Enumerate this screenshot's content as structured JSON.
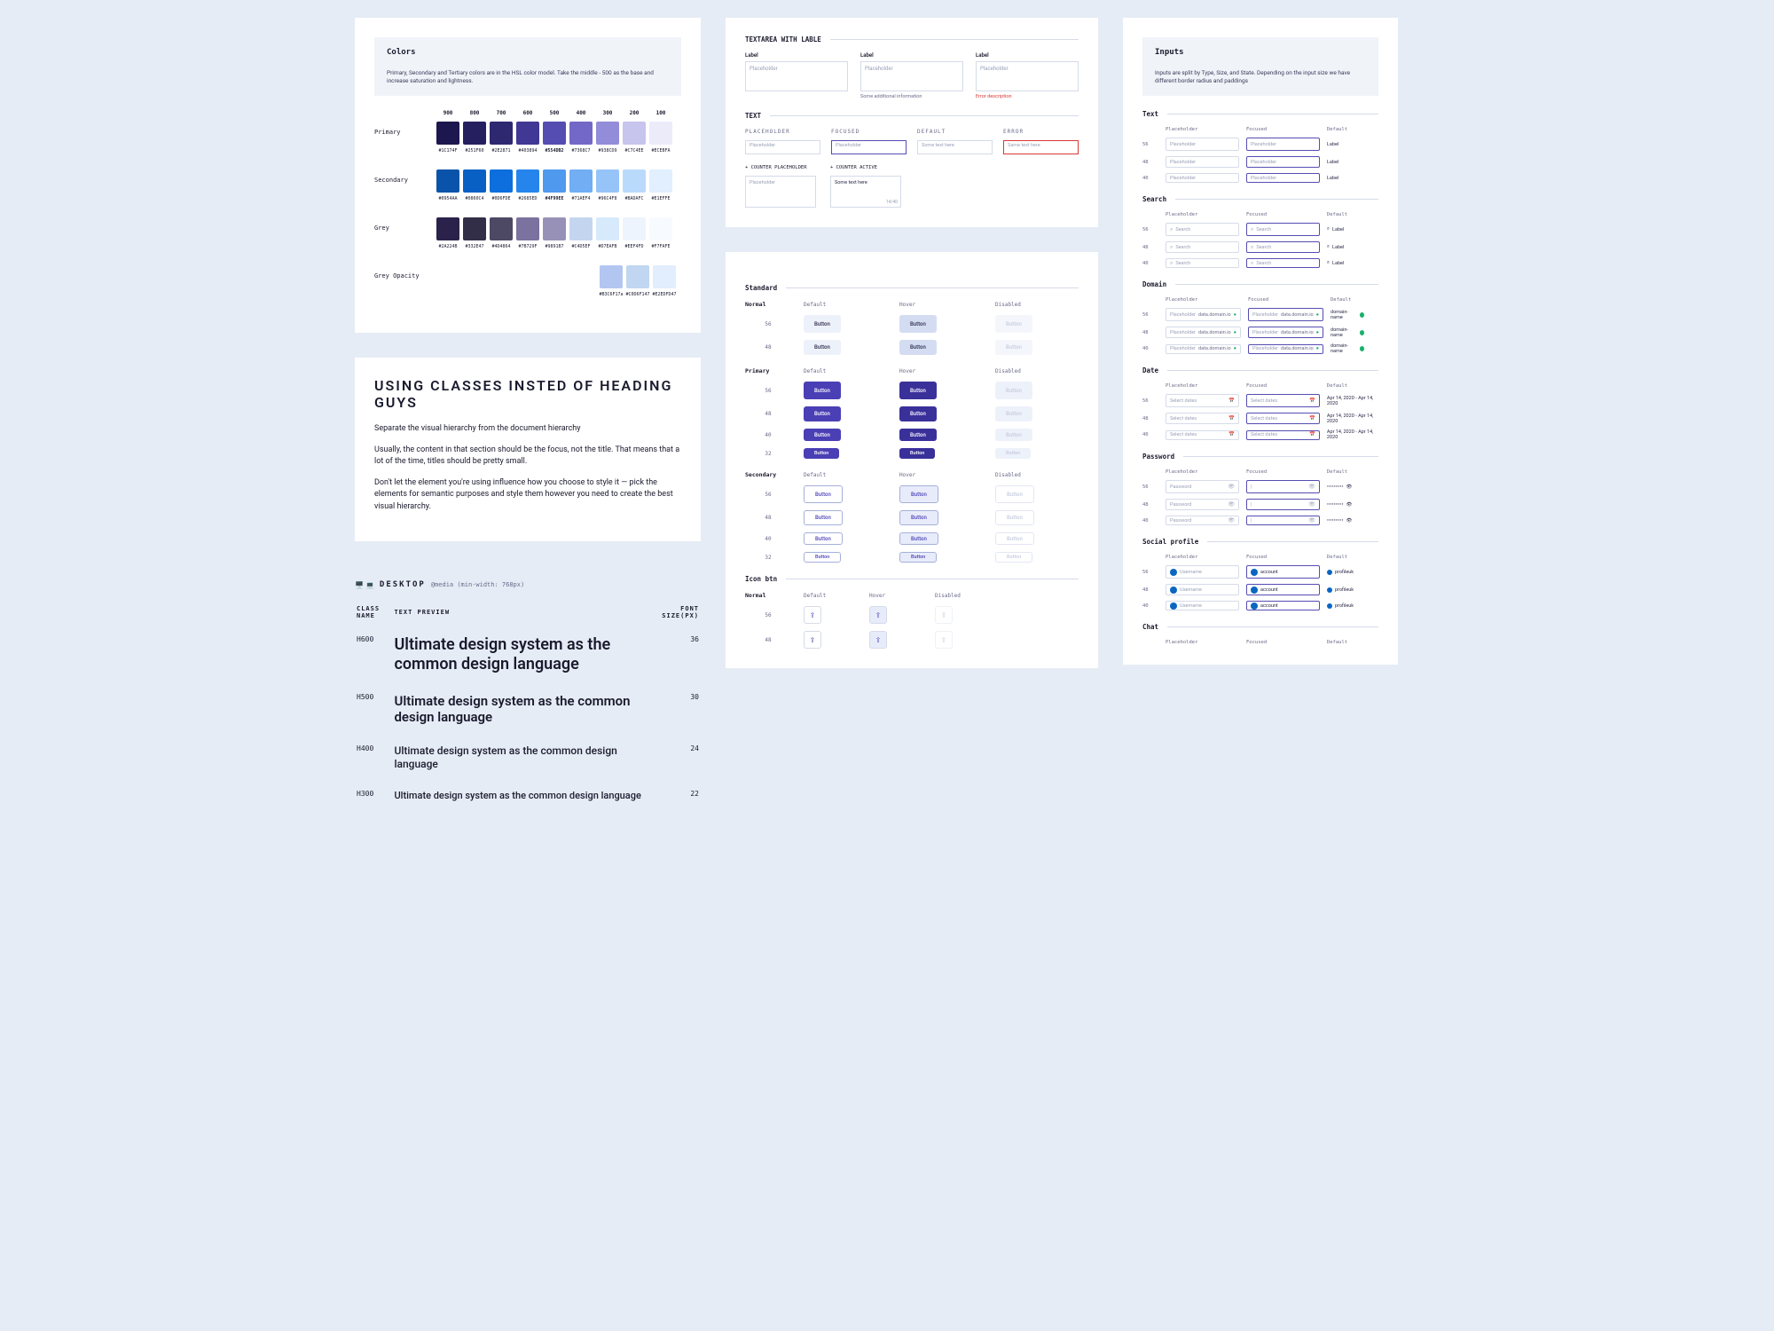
{
  "colorsPanel": {
    "title": "Colors",
    "description": "Primary, Secondary and Tertiary colors are in the HSL color model. Take the middle - 500 as the base and increase saturation and lightness.",
    "scaleLabels": [
      "900",
      "800",
      "700",
      "600",
      "500",
      "400",
      "300",
      "200",
      "100"
    ],
    "rows": [
      {
        "label": "Primary",
        "swatches": [
          {
            "hex": "#1C174F",
            "bold": false
          },
          {
            "hex": "#251F60",
            "bold": false
          },
          {
            "hex": "#2E2871",
            "bold": false
          },
          {
            "hex": "#403894",
            "bold": false
          },
          {
            "hex": "#554DB2",
            "bold": true
          },
          {
            "hex": "#7368C7",
            "bold": false
          },
          {
            "hex": "#938CD9",
            "bold": false
          },
          {
            "hex": "#C7C4EE",
            "bold": false
          },
          {
            "hex": "#ECEBFA",
            "bold": false
          }
        ]
      },
      {
        "label": "Secondary",
        "swatches": [
          {
            "hex": "#0954AA",
            "bold": false
          },
          {
            "hex": "#0860C4",
            "bold": false
          },
          {
            "hex": "#0D6FDE",
            "bold": false
          },
          {
            "hex": "#2685ED",
            "bold": false
          },
          {
            "hex": "#4F99EE",
            "bold": true
          },
          {
            "hex": "#71AEF4",
            "bold": false
          },
          {
            "hex": "#96C4F8",
            "bold": false
          },
          {
            "hex": "#BADAFC",
            "bold": false
          },
          {
            "hex": "#E1EFFE",
            "bold": false
          }
        ]
      },
      {
        "label": "Grey",
        "swatches": [
          {
            "hex": "#2A224B",
            "bold": false
          },
          {
            "hex": "#332E47",
            "bold": false
          },
          {
            "hex": "#4D4864",
            "bold": false
          },
          {
            "hex": "#7B729F",
            "bold": false
          },
          {
            "hex": "#9891B7",
            "bold": false
          },
          {
            "hex": "#C4D5EF",
            "bold": false
          },
          {
            "hex": "#D7EAFB",
            "bold": false
          },
          {
            "hex": "#EEF4FD",
            "bold": false
          },
          {
            "hex": "#F7FAFE",
            "bold": false
          }
        ]
      }
    ],
    "opacityRow": {
      "label": "Grey Opacity",
      "swatches": [
        {
          "hex": "#B3C6F17a",
          "bold": false
        },
        {
          "hex": "#C0D6F147",
          "bold": false
        },
        {
          "hex": "#E2EDFD47",
          "bold": false
        }
      ]
    }
  },
  "typography": {
    "title": "USING CLASSES INSTED OF HEADING GUYS",
    "p1": "Separate the visual hierarchy from the document hierarchy",
    "p2": "Usually, the content in that section should be the focus, not the title. That means that a lot of the time, titles should be pretty small.",
    "p3": "Don't let the element you're using influence how you choose to style it — pick the elements for semantic purposes and style them however you need to create the best visual hierarchy.",
    "deviceLabel": "DESKTOP",
    "deviceMeta": "@media (min-width: 768px)",
    "cols": {
      "class": "CLASS NAME",
      "preview": "TEXT PREVIEW",
      "size": "FONT SIZE(PX)"
    },
    "rows": [
      {
        "cls": "H600",
        "sz": "36",
        "text": "Ultimate design system as the common design language"
      },
      {
        "cls": "H500",
        "sz": "30",
        "text": "Ultimate design system as the common design language"
      },
      {
        "cls": "H400",
        "sz": "24",
        "text": "Ultimate design system as the common design language"
      },
      {
        "cls": "H300",
        "sz": "22",
        "text": "Ultimate design system as the common design language"
      }
    ]
  },
  "textarea": {
    "title": "TEXTAREA WITH LABLE",
    "labels": {
      "label": "Label",
      "placeholder": "Placeholder",
      "helper": "Some additional information",
      "error": "Error description"
    }
  },
  "textStates": {
    "title": "TEXT",
    "states": [
      "PLACEHOLDER",
      "FOCUSED",
      "DEFAULT",
      "ERROR"
    ],
    "placeholder": "Placeholder",
    "default": "Some text here",
    "error": "Same text here",
    "counterPlaceholder": "+ COUNTER PLACEHOLDER",
    "counterActive": "+ COUNTER ACTIVE",
    "counterText": "Some text here",
    "count": "14/40"
  },
  "buttons": {
    "title": "Standard",
    "iconTitle": "Icon btn",
    "cols": [
      "Default",
      "Hover",
      "Disabled"
    ],
    "sizes": [
      "56",
      "48",
      "40",
      "32"
    ],
    "variants": [
      "Normal",
      "Primary",
      "Secondary"
    ],
    "btnLabel": "Button"
  },
  "inputs": {
    "title": "Inputs",
    "description": "Inputs are split by Type, Size, and State.\nDepending on the input size we have different border radius and paddings",
    "cols": [
      "Placeholder",
      "Focused",
      "Default"
    ],
    "sizes": [
      "56",
      "48",
      "40"
    ],
    "text": {
      "title": "Text",
      "ph": "Placeholder",
      "def": "Label"
    },
    "search": {
      "title": "Search",
      "ph": "Search",
      "def": "Label"
    },
    "domain": {
      "title": "Domain",
      "ph": "Placeholder",
      "suffix": "data.domain.io",
      "def": "domain-name"
    },
    "date": {
      "title": "Date",
      "ph": "Select dates",
      "def": "Apr 14, 2020 - Apr 14, 2020"
    },
    "password": {
      "title": "Password",
      "ph": "Password",
      "def": "••••••••••"
    },
    "social": {
      "title": "Social profile",
      "ph": "Username",
      "foc": "account",
      "def": "profileuk"
    },
    "chat": {
      "title": "Chat"
    }
  }
}
